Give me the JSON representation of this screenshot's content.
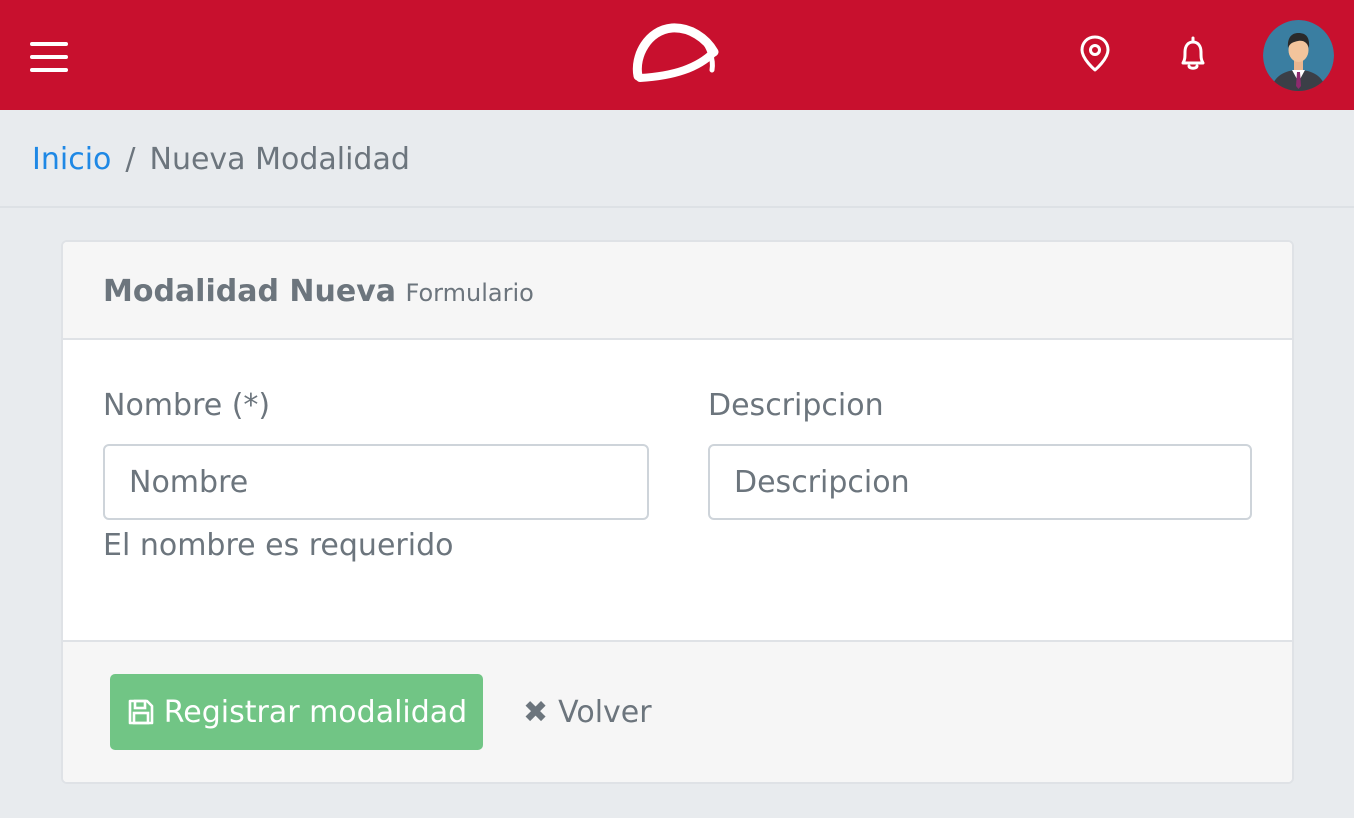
{
  "colors": {
    "topbar": "#c8102e",
    "link": "#1e88e5",
    "success": "#71c585",
    "text_muted": "#6c757d",
    "page_bg": "#e8ebee"
  },
  "topbar": {
    "menu_icon": "hamburger-menu-icon",
    "logo_icon": "brand-logo",
    "location_icon": "map-pin-icon",
    "notifications_icon": "bell-icon",
    "avatar_icon": "user-avatar"
  },
  "breadcrumb": {
    "home": "Inicio",
    "separator": "/",
    "current": "Nueva Modalidad"
  },
  "card": {
    "title": "Modalidad Nueva",
    "subtitle": "Formulario"
  },
  "form": {
    "nombre": {
      "label": "Nombre (*)",
      "placeholder": "Nombre",
      "value": "",
      "help": "El nombre es requerido"
    },
    "descripcion": {
      "label": "Descripcion",
      "placeholder": "Descripcion",
      "value": ""
    }
  },
  "actions": {
    "save_icon": "floppy-disk-icon",
    "save_label": "Registrar modalidad",
    "back_icon": "close-x-icon",
    "back_label": "Volver"
  }
}
